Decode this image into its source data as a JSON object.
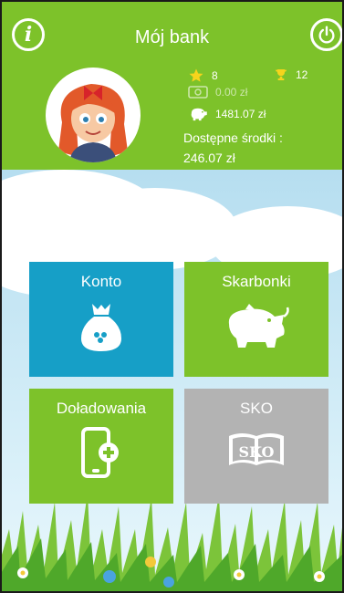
{
  "header": {
    "title": "Mój bank",
    "info_icon": "info-icon",
    "power_icon": "power-icon",
    "accent_color": "#7dc22a"
  },
  "stats": {
    "stars": "8",
    "trophies": "12",
    "cash": "0.00 zł",
    "piggy_total": "1481.07 zł",
    "available_label": "Dostępne środki :",
    "available_value": "246.07 zł"
  },
  "tiles": [
    {
      "label": "Konto",
      "icon": "money-bag-icon",
      "color": "#169fc7"
    },
    {
      "label": "Skarbonki",
      "icon": "piggy-bank-icon",
      "color": "#7dc22a"
    },
    {
      "label": "Doładowania",
      "icon": "phone-topup-icon",
      "color": "#7dc22a"
    },
    {
      "label": "SKO",
      "icon": "sko-book-icon",
      "sko_text": "SKO",
      "color": "#b3b3b3"
    }
  ]
}
